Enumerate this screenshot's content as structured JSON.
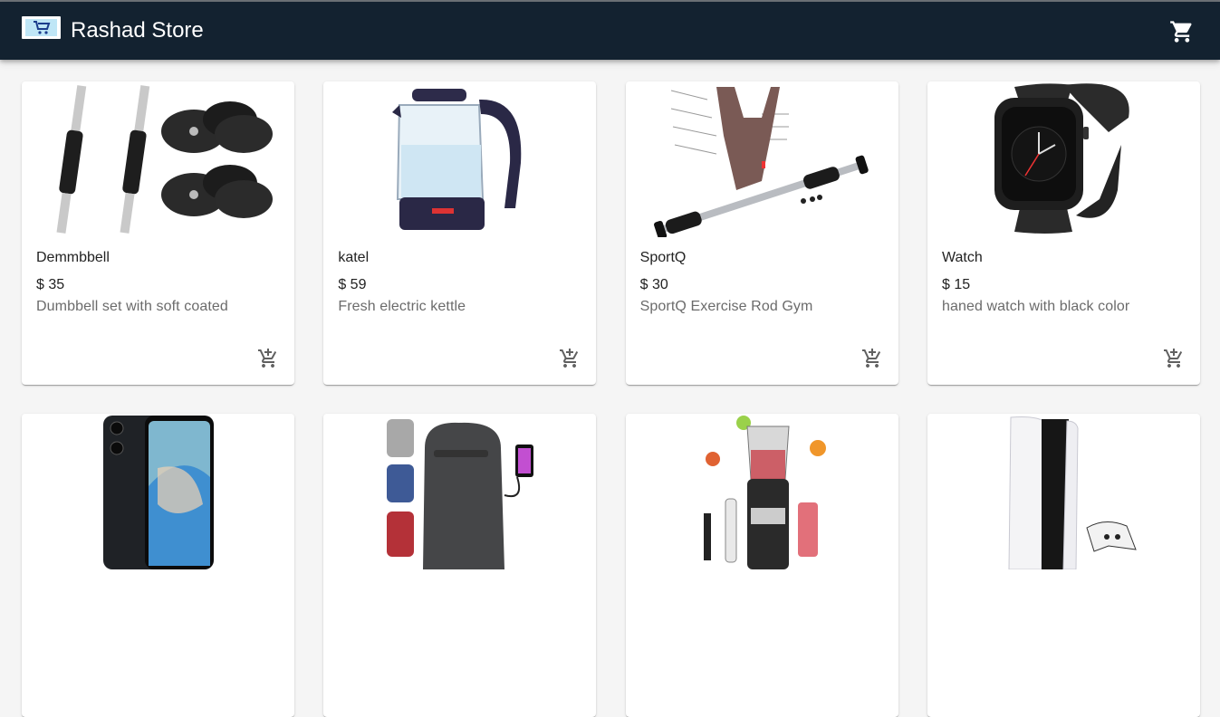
{
  "header": {
    "brand": "Rashad Store",
    "logo_icon": "shopping-cart-logo",
    "cart_icon": "shopping-cart-icon",
    "background": "#132230"
  },
  "products": [
    {
      "name": "Demmbbell",
      "price": "$ 35",
      "description": "Dumbbell set with soft coated",
      "image": "dumbbell-set"
    },
    {
      "name": "katel",
      "price": "$ 59",
      "description": "Fresh electric kettle",
      "image": "electric-kettle"
    },
    {
      "name": "SportQ",
      "price": "$ 30",
      "description": "SportQ Exercise Rod Gym",
      "image": "pull-up-bar"
    },
    {
      "name": "Watch",
      "price": "$ 15",
      "description": "haned watch with black color",
      "image": "smart-watch"
    },
    {
      "name": "",
      "price": "",
      "description": "",
      "image": "smartphone"
    },
    {
      "name": "",
      "price": "",
      "description": "",
      "image": "backpack"
    },
    {
      "name": "",
      "price": "",
      "description": "",
      "image": "blender"
    },
    {
      "name": "",
      "price": "",
      "description": "",
      "image": "game-console"
    }
  ],
  "add_to_cart_icon": "add-shopping-cart-icon"
}
